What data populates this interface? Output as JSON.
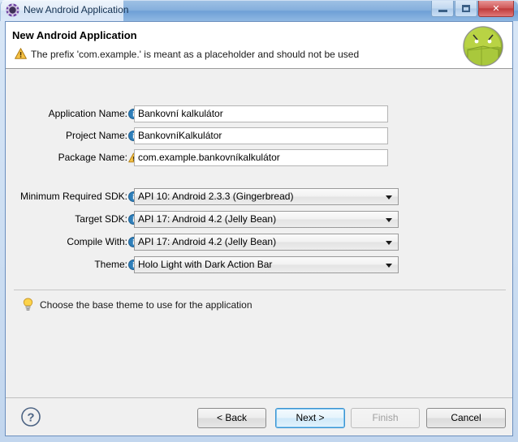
{
  "titlebar": {
    "title": "New Android Application",
    "icon": "android-wizard-icon",
    "minimize_label": "Minimize",
    "maximize_label": "Maximize",
    "close_label": "Close"
  },
  "header": {
    "title": "New Android Application",
    "message": "The prefix 'com.example.' is meant as a placeholder and should not be used",
    "message_icon": "warning-icon",
    "logo_icon": "android-robot-icon"
  },
  "form": {
    "fields": [
      {
        "label": "Application Name:",
        "icon": "info-icon",
        "type": "text",
        "value": "Bankovní kalkulátor"
      },
      {
        "label": "Project Name:",
        "icon": "info-icon",
        "type": "text",
        "value": "BankovníKalkulátor"
      },
      {
        "label": "Package Name:",
        "icon": "warning-icon",
        "type": "text",
        "value": "com.example.bankovníkalkulátor"
      },
      {
        "label": "Minimum Required SDK:",
        "icon": "info-icon",
        "type": "combo",
        "value": "API 10: Android 2.3.3 (Gingerbread)"
      },
      {
        "label": "Target SDK:",
        "icon": "info-icon",
        "type": "combo",
        "value": "API 17: Android 4.2 (Jelly Bean)"
      },
      {
        "label": "Compile With:",
        "icon": "info-icon",
        "type": "combo",
        "value": "API 17: Android 4.2 (Jelly Bean)"
      },
      {
        "label": "Theme:",
        "icon": "info-icon",
        "type": "combo",
        "value": "Holo Light with Dark Action Bar"
      }
    ]
  },
  "hint": {
    "icon": "lightbulb-icon",
    "text": "Choose the base theme to use for the application"
  },
  "buttonbar": {
    "help_icon": "help-icon",
    "back": "< Back",
    "next": "Next >",
    "finish": "Finish",
    "cancel": "Cancel"
  },
  "colors": {
    "accent": "#3c93d0",
    "warning": "#e8a317",
    "info": "#2b6ca3",
    "android_green": "#a4c639",
    "close_red": "#bf3b3b"
  }
}
